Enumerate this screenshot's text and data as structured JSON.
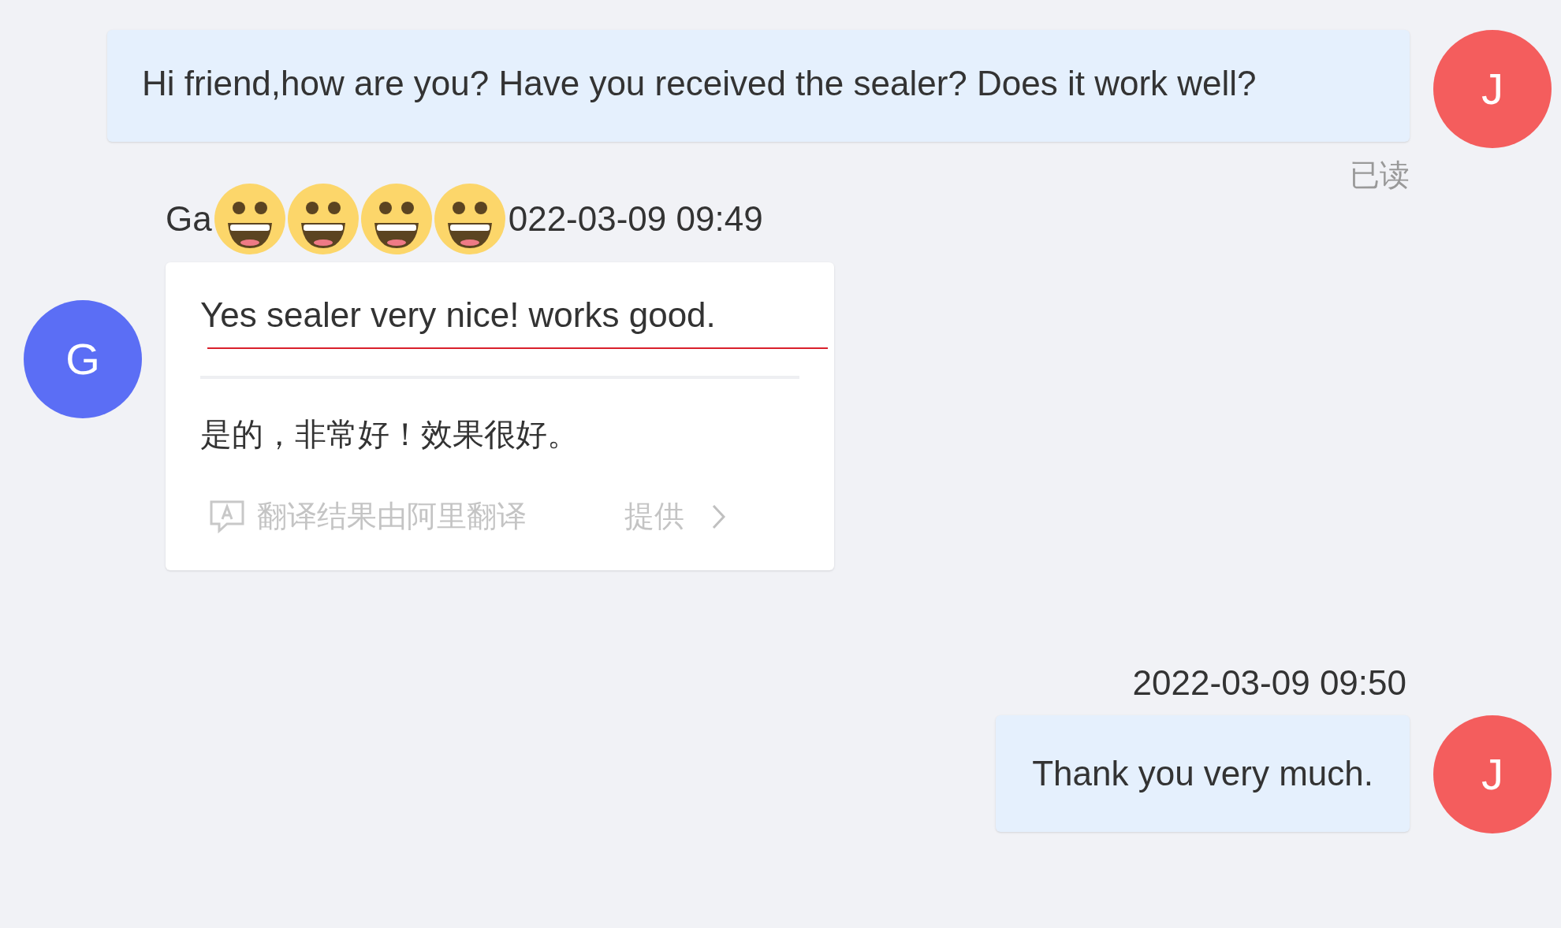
{
  "messages": [
    {
      "kind": "outgoing",
      "avatar": "J",
      "text": "Hi friend,how are you? Have you received the sealer? Does it work well?",
      "receipt": "已读"
    },
    {
      "kind": "incoming",
      "avatar": "G",
      "sender": "Ga",
      "stickers": [
        {
          "kind": "grin"
        },
        {
          "kind": "grin"
        },
        {
          "kind": "grin"
        },
        {
          "kind": "grin"
        }
      ],
      "time": "022-03-09 09:49",
      "text": "Yes sealer very nice! works good.",
      "translation": "是的，非常好！效果很好。",
      "translation_note": [
        "翻译结果由阿里翻译",
        "提供"
      ]
    },
    {
      "kind": "outgoing",
      "avatar": "J",
      "time": "2022-03-09 09:50",
      "text": "Thank you very much."
    }
  ]
}
